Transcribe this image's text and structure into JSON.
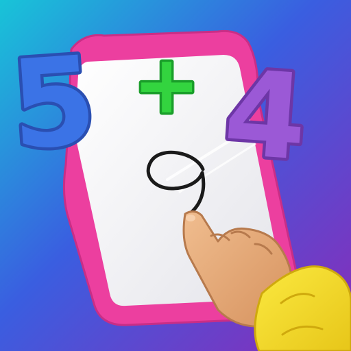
{
  "app_icon": {
    "equation": {
      "first_operand": "5",
      "operator": "+",
      "second_operand": "4",
      "traced_answer": "9"
    },
    "colors": {
      "background_top_left": "#18c4d8",
      "background_mid": "#3a5ee0",
      "background_bottom_right": "#8a2bb8",
      "board_frame": "#ec3f9f",
      "board_surface": "#f2f2f6",
      "operand_1": "#3b73e6",
      "operator": "#33d43f",
      "operand_2": "#9b59d6",
      "answer_stroke": "#1a1a1a",
      "hand_skin": "#e6ad7c",
      "sleeve": "#f5e12b"
    },
    "icons": {
      "board": "whiteboard-icon",
      "hand": "pointing-hand-icon",
      "sleeve": "yellow-sleeve-icon"
    }
  }
}
